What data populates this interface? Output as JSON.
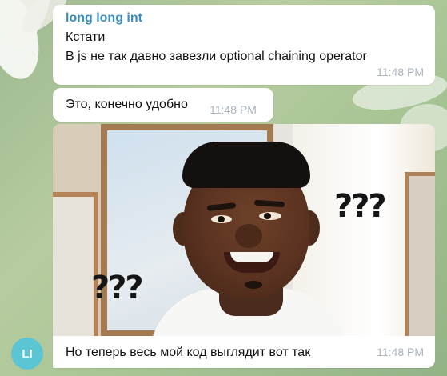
{
  "messages": [
    {
      "sender": "long long int",
      "lines": [
        "Кстати",
        "В js не так давно завезли optional chaining operator"
      ],
      "time": "11:48 PM"
    },
    {
      "text": "Это, конечно удобно",
      "time": "11:48 PM"
    },
    {
      "image": {
        "overlay_text_right": "???",
        "overlay_text_left": "???"
      },
      "caption": "Но теперь весь мой код выглядит вот так",
      "time": "11:48 PM"
    }
  ],
  "avatar": {
    "initials": "LI",
    "color": "#5cc5d3"
  },
  "colors": {
    "sender_name": "#3a8fbf",
    "timestamp": "#a8b3bd",
    "bubble": "#ffffff"
  }
}
